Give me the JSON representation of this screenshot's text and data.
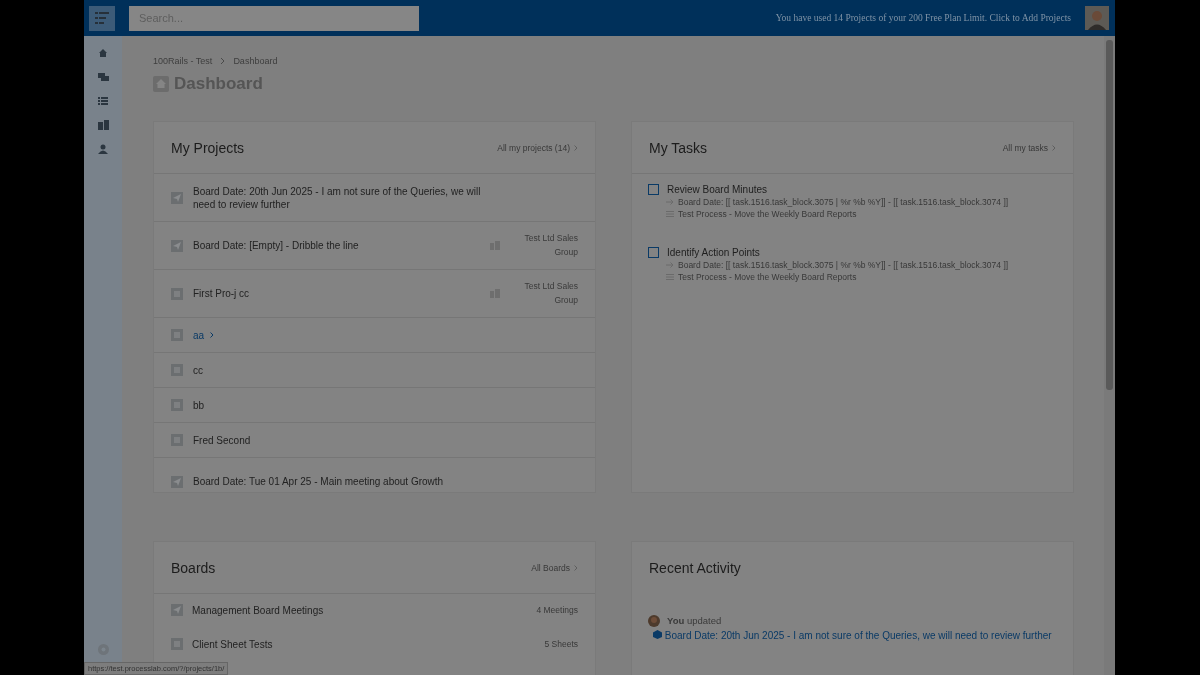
{
  "topbar": {
    "search": {
      "placeholder": "Search..."
    },
    "plan_notice": "You have used 14 Projects of your 200 Free Plan Limit. Click to Add Projects"
  },
  "breadcrumb": [
    "100Rails - Test",
    "Dashboard"
  ],
  "page_title": "Dashboard",
  "projects": {
    "title": "My Projects",
    "link": "All my projects (14)",
    "items": [
      {
        "kind": "board",
        "title": "Board Date: 20th Jun 2025 - I am not sure of the Queries, we will need to review further",
        "hovered": false
      },
      {
        "kind": "board",
        "title": "Board Date: [Empty] - Dribble the line",
        "client": "Test Ltd Sales Group",
        "hovered": false
      },
      {
        "kind": "sheet",
        "title": "First Pro-j cc",
        "client": "Test Ltd Sales Group",
        "hovered": false
      },
      {
        "kind": "sheet",
        "title": "aa",
        "hovered": true
      },
      {
        "kind": "sheet",
        "title": "cc",
        "hovered": false
      },
      {
        "kind": "sheet",
        "title": "bb",
        "hovered": false
      },
      {
        "kind": "sheet",
        "title": "Fred Second",
        "hovered": false
      },
      {
        "kind": "board",
        "title": "Board Date: Tue 01 Apr 25 - Main meeting about Growth",
        "hovered": false
      }
    ]
  },
  "tasks": {
    "title": "My Tasks",
    "link": "All my tasks",
    "items": [
      {
        "title": "Review Board Minutes",
        "checked": false,
        "board": "Board Date: [[ task.1516.task_block.3075 | %r %b %Y]] - [[ task.1516.task_block.3074 ]]",
        "process": "Test Process - Move the Weekly Board Reports"
      },
      {
        "title": "Identify Action Points",
        "checked": false,
        "board": "Board Date: [[ task.1516.task_block.3075 | %r %b %Y]] - [[ task.1516.task_block.3074 ]]",
        "process": "Test Process - Move the Weekly Board Reports"
      }
    ]
  },
  "boards": {
    "title": "Boards",
    "link": "All Boards",
    "items": [
      {
        "kind": "board",
        "title": "Management Board Meetings",
        "count": "4 Meetings"
      },
      {
        "kind": "sheet",
        "title": "Client Sheet Tests",
        "count": "5 Sheets"
      }
    ]
  },
  "activity": {
    "title": "Recent Activity",
    "items": [
      {
        "actor": "**You** updated",
        "link": "Board Date: 20th Jun 2025 - I am not sure of the Queries, we will need to review further"
      }
    ]
  },
  "status_url": "https://test.processlab.com/?/projects/1b/"
}
